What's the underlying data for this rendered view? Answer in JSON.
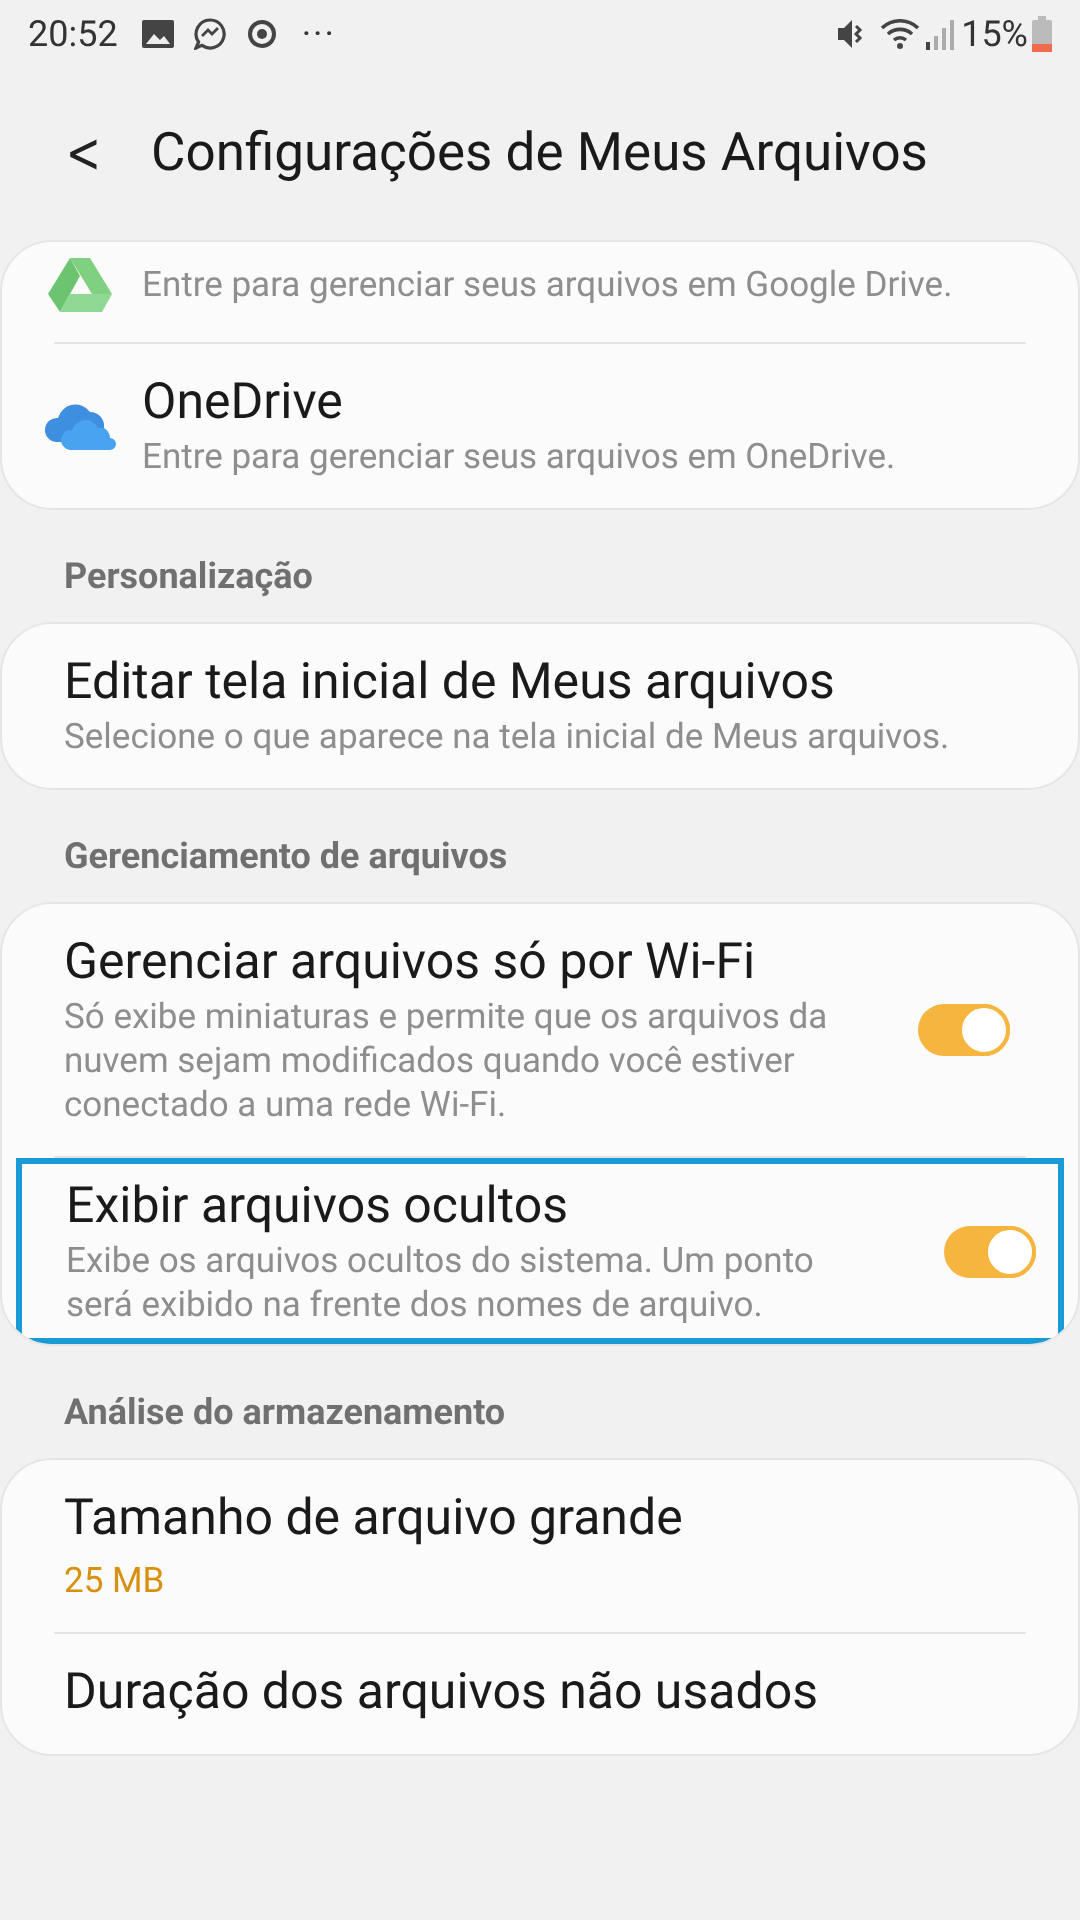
{
  "status_bar": {
    "time": "20:52",
    "more": "···",
    "battery": "15%"
  },
  "header": {
    "back": "<",
    "title": "Configurações de Meus Arquivos"
  },
  "sections": [
    {
      "items": [
        {
          "kind": "account",
          "subtitle": "Entre para gerenciar seus arquivos em Google Drive."
        },
        {
          "kind": "account",
          "title": "OneDrive",
          "subtitle": "Entre para gerenciar seus arquivos em OneDrive."
        }
      ]
    },
    {
      "heading": "Personalização",
      "items": [
        {
          "kind": "plain",
          "title": "Editar tela inicial de Meus arquivos",
          "subtitle": "Selecione o que aparece na tela inicial de Meus arquivos."
        }
      ]
    },
    {
      "heading": "Gerenciamento de arquivos",
      "items": [
        {
          "kind": "toggle",
          "title": "Gerenciar arquivos só por Wi-Fi",
          "subtitle": "Só exibe miniaturas e permite que os arquivos da nuvem sejam modificados quando você estiver conectado a uma rede Wi-Fi.",
          "on": true,
          "highlighted": false
        },
        {
          "kind": "toggle",
          "title": "Exibir arquivos ocultos",
          "subtitle": "Exibe os arquivos ocultos do sistema. Um ponto será exibido na frente dos nomes de arquivo.",
          "on": true,
          "highlighted": true
        }
      ]
    },
    {
      "heading": "Análise do armazenamento",
      "items": [
        {
          "kind": "value",
          "title": "Tamanho de arquivo grande",
          "value": "25 MB"
        },
        {
          "kind": "plain",
          "title": "Duração dos arquivos não usados"
        }
      ]
    }
  ]
}
